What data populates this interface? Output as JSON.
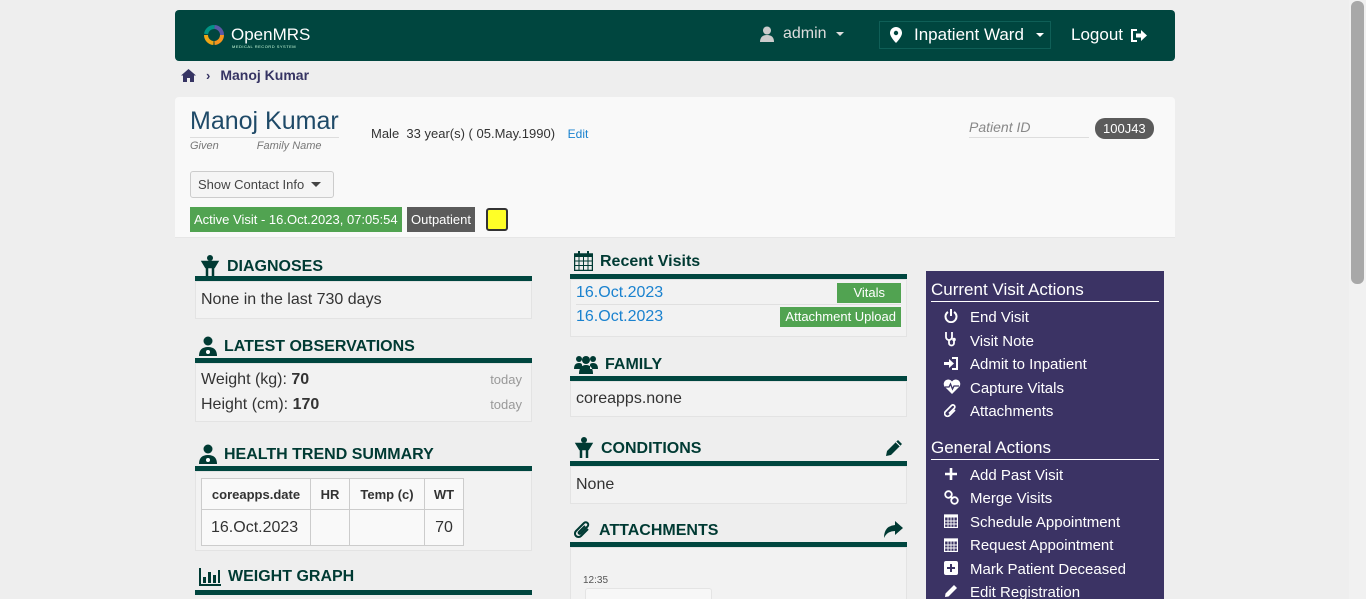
{
  "header": {
    "logo_text": "OpenMRS",
    "logo_subtext": "MEDICAL RECORD SYSTEM",
    "user": "admin",
    "location": "Inpatient Ward",
    "logout": "Logout"
  },
  "breadcrumb": {
    "patient": "Manoj Kumar"
  },
  "patient": {
    "name": "Manoj Kumar",
    "given_label": "Given",
    "family_label": "Family Name",
    "gender": "Male",
    "age_dob": "33 year(s) ( 05.May.1990)",
    "edit": "Edit",
    "patient_id_label": "Patient ID",
    "patient_id": "100J43",
    "contact_button": "Show Contact Info",
    "active_visit": "Active Visit - 16.Oct.2023, 07:05:54",
    "visit_type": "Outpatient"
  },
  "diagnoses": {
    "title": "DIAGNOSES",
    "body": "None in the last 730 days"
  },
  "observations": {
    "title": "LATEST OBSERVATIONS",
    "rows": [
      {
        "label": "Weight (kg):",
        "value": "70",
        "when": "today"
      },
      {
        "label": "Height (cm):",
        "value": "170",
        "when": "today"
      }
    ]
  },
  "health_trend": {
    "title": "HEALTH TREND SUMMARY",
    "columns": [
      "coreapps.date",
      "HR",
      "Temp (c)",
      "WT"
    ],
    "row": [
      "16.Oct.2023",
      "",
      "",
      "70"
    ]
  },
  "weight_graph": {
    "title": "WEIGHT GRAPH"
  },
  "recent_visits": {
    "title": "Recent Visits",
    "rows": [
      {
        "date": "16.Oct.2023",
        "tag": "Vitals"
      },
      {
        "date": "16.Oct.2023",
        "tag": "Attachment Upload"
      }
    ]
  },
  "family": {
    "title": "FAMILY",
    "body": "coreapps.none"
  },
  "conditions": {
    "title": "CONDITIONS",
    "body": "None"
  },
  "attachments": {
    "title": "ATTACHMENTS",
    "thumb_time": "12:35"
  },
  "sidebar": {
    "current_heading": "Current Visit Actions",
    "current_items": [
      "End Visit",
      "Visit Note",
      "Admit to Inpatient",
      "Capture Vitals",
      "Attachments"
    ],
    "general_heading": "General Actions",
    "general_items": [
      "Add Past Visit",
      "Merge Visits",
      "Schedule Appointment",
      "Request Appointment",
      "Mark Patient Deceased",
      "Edit Registration"
    ]
  },
  "colors": {
    "header": "#00463f",
    "sidebar": "#3b3364",
    "badge_green": "#51a351",
    "link": "#1a82cf"
  }
}
